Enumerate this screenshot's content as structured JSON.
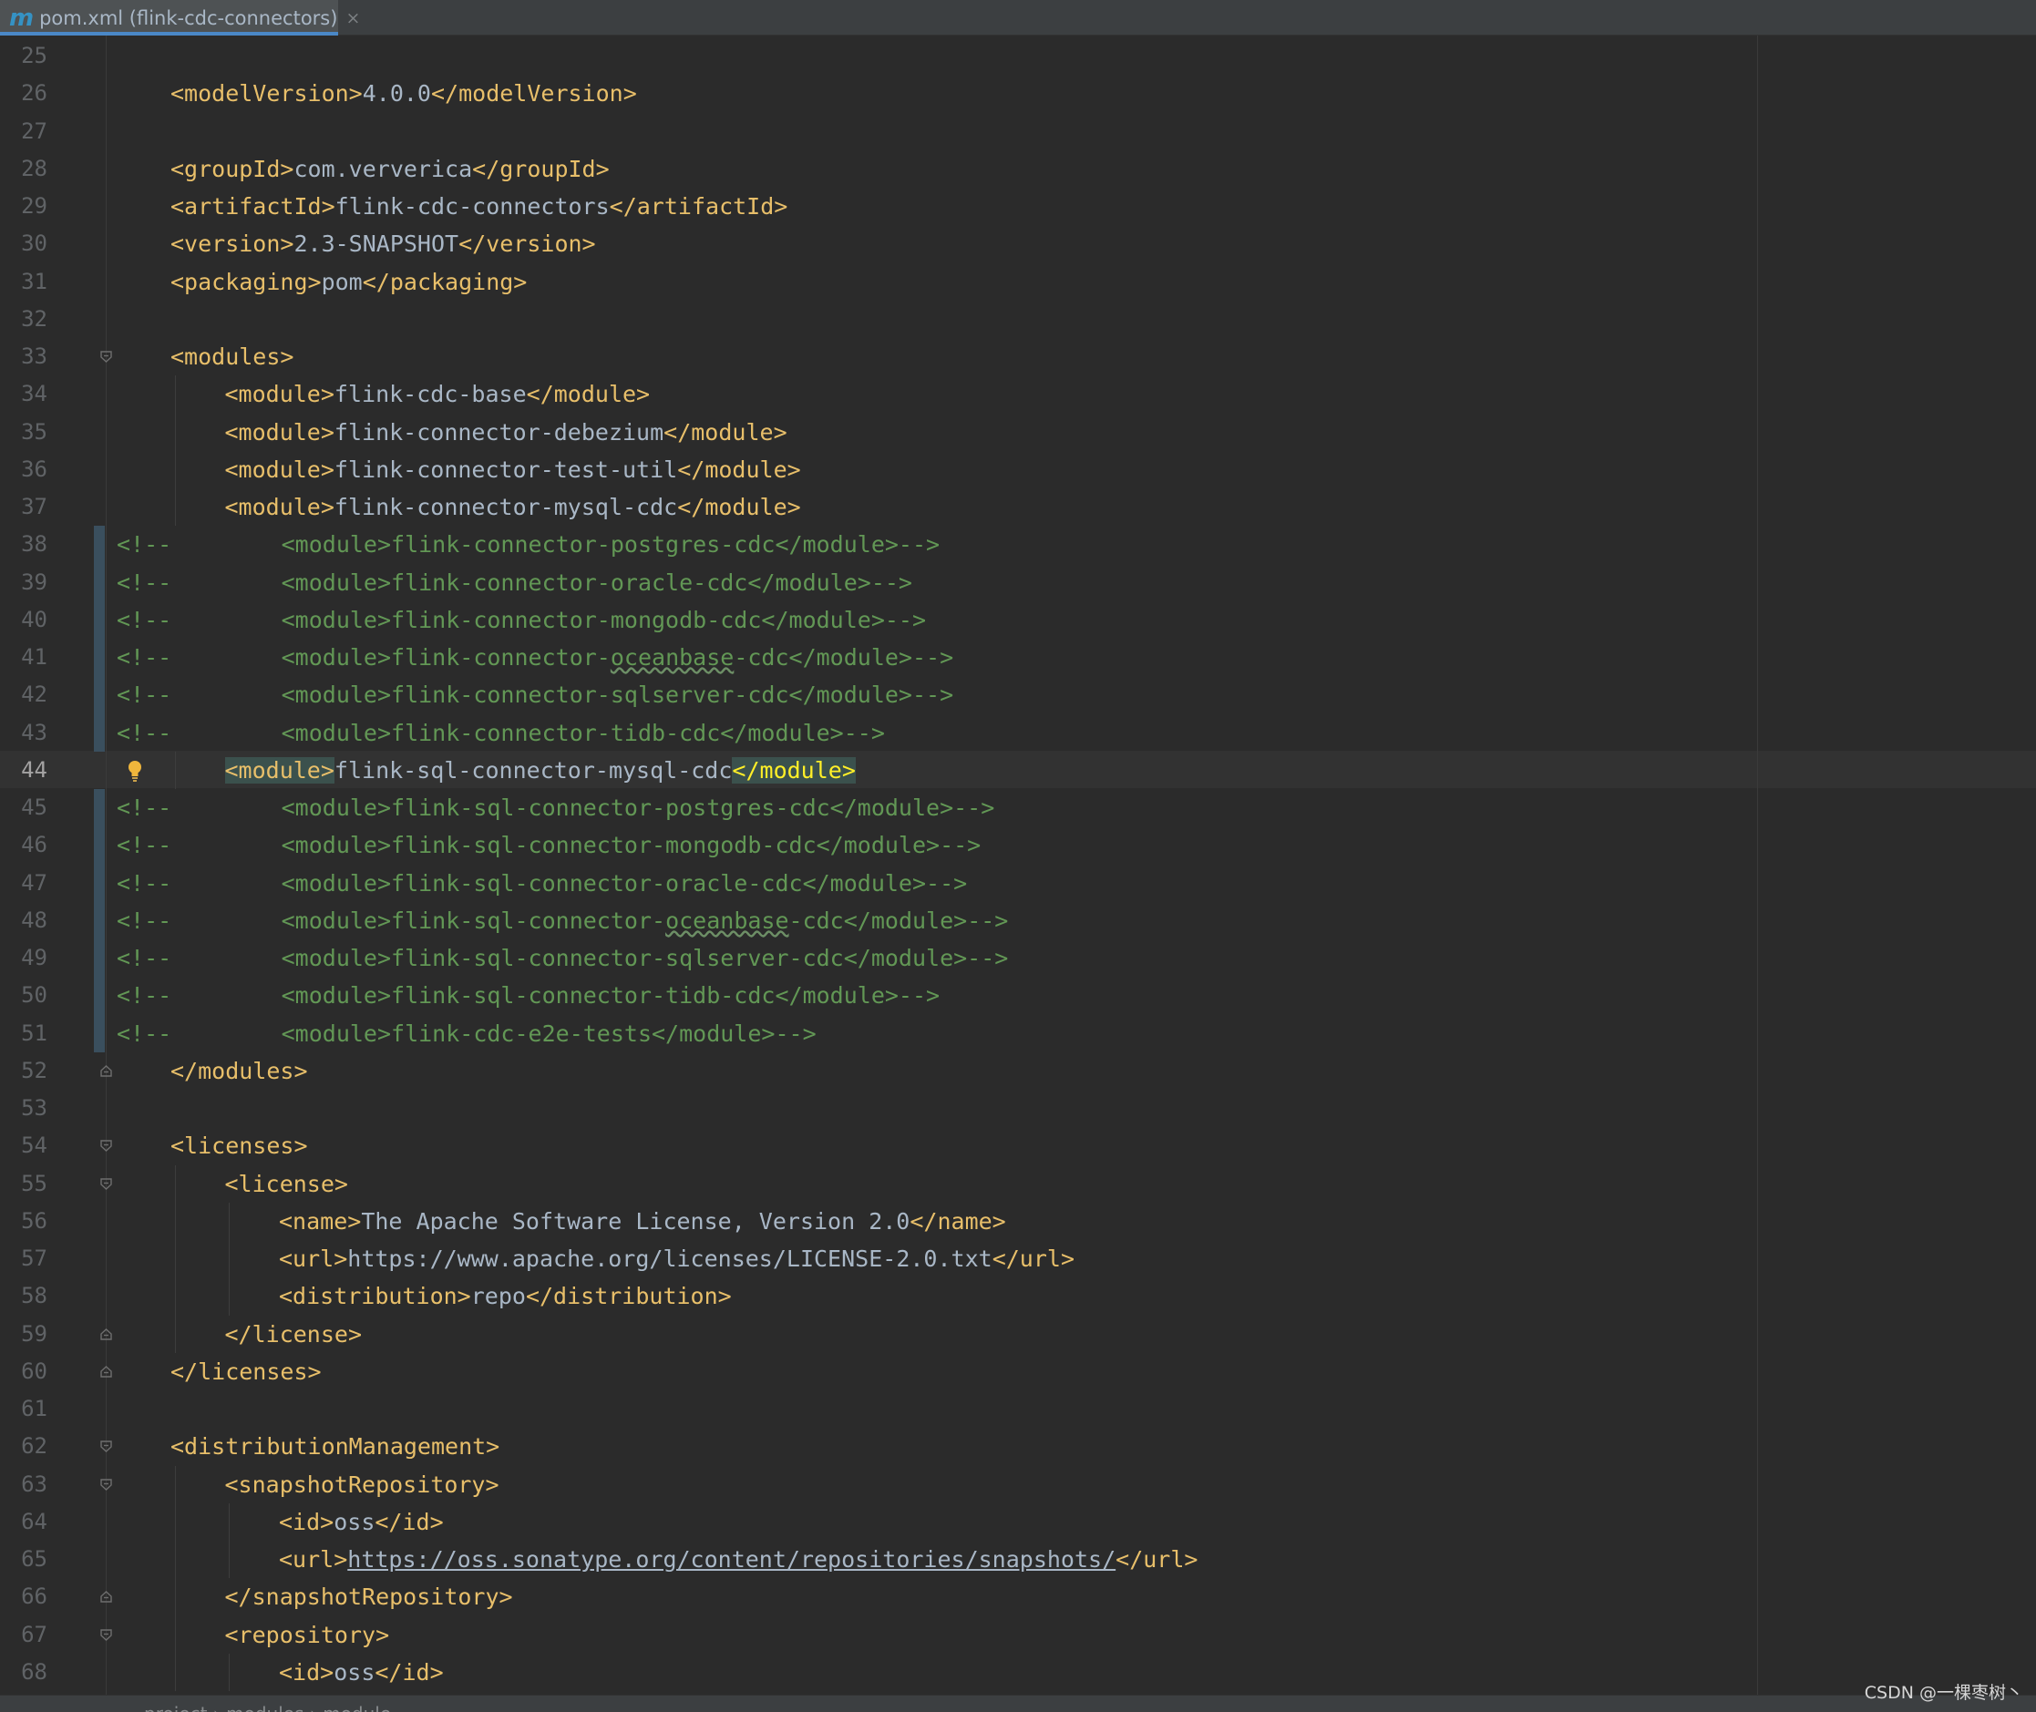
{
  "tab": {
    "icon": "m",
    "icon_name": "maven-icon",
    "title": "pom.xml (flink-cdc-connectors)",
    "close": "×"
  },
  "editor": {
    "current_line": 44,
    "lines": [
      {
        "n": "25",
        "parts": []
      },
      {
        "n": "26",
        "indent": 1,
        "parts": [
          [
            "tag",
            "<modelVersion>"
          ],
          [
            "txt",
            "4.0.0"
          ],
          [
            "tag",
            "</modelVersion>"
          ]
        ]
      },
      {
        "n": "27",
        "parts": []
      },
      {
        "n": "28",
        "indent": 1,
        "parts": [
          [
            "tag",
            "<groupId>"
          ],
          [
            "txt",
            "com.ververica"
          ],
          [
            "tag",
            "</groupId>"
          ]
        ]
      },
      {
        "n": "29",
        "indent": 1,
        "parts": [
          [
            "tag",
            "<artifactId>"
          ],
          [
            "txt",
            "flink-cdc-connectors"
          ],
          [
            "tag",
            "</artifactId>"
          ]
        ]
      },
      {
        "n": "30",
        "indent": 1,
        "parts": [
          [
            "tag",
            "<version>"
          ],
          [
            "txt",
            "2.3-SNAPSHOT"
          ],
          [
            "tag",
            "</version>"
          ]
        ]
      },
      {
        "n": "31",
        "indent": 1,
        "parts": [
          [
            "tag",
            "<packaging>"
          ],
          [
            "txt",
            "pom"
          ],
          [
            "tag",
            "</packaging>"
          ]
        ]
      },
      {
        "n": "32",
        "parts": []
      },
      {
        "n": "33",
        "indent": 1,
        "fold": "open",
        "parts": [
          [
            "tag",
            "<modules>"
          ]
        ]
      },
      {
        "n": "34",
        "indent": 2,
        "parts": [
          [
            "tag",
            "<module>"
          ],
          [
            "txt",
            "flink-cdc-base"
          ],
          [
            "tag",
            "</module>"
          ]
        ]
      },
      {
        "n": "35",
        "indent": 2,
        "parts": [
          [
            "tag",
            "<module>"
          ],
          [
            "txt",
            "flink-connector-debezium"
          ],
          [
            "tag",
            "</module>"
          ]
        ]
      },
      {
        "n": "36",
        "indent": 2,
        "parts": [
          [
            "tag",
            "<module>"
          ],
          [
            "txt",
            "flink-connector-test-util"
          ],
          [
            "tag",
            "</module>"
          ]
        ]
      },
      {
        "n": "37",
        "indent": 2,
        "parts": [
          [
            "tag",
            "<module>"
          ],
          [
            "txt",
            "flink-connector-mysql-cdc"
          ],
          [
            "tag",
            "</module>"
          ]
        ]
      },
      {
        "n": "38",
        "changed": true,
        "parts": [
          [
            "cmt",
            "<!--        <module>flink-connector-postgres-cdc</module>-->"
          ]
        ]
      },
      {
        "n": "39",
        "changed": true,
        "parts": [
          [
            "cmt",
            "<!--        <module>flink-connector-oracle-cdc</module>-->"
          ]
        ]
      },
      {
        "n": "40",
        "changed": true,
        "parts": [
          [
            "cmt",
            "<!--        <module>flink-connector-mongodb-cdc</module>-->"
          ]
        ]
      },
      {
        "n": "41",
        "changed": true,
        "parts": [
          [
            "cmt",
            "<!--        <module>flink-connector-"
          ],
          [
            "cmtw",
            "oceanbase"
          ],
          [
            "cmt",
            "-cdc</module>-->"
          ]
        ]
      },
      {
        "n": "42",
        "changed": true,
        "parts": [
          [
            "cmt",
            "<!--        <module>flink-connector-sqlserver-cdc</module>-->"
          ]
        ]
      },
      {
        "n": "43",
        "changed": true,
        "parts": [
          [
            "cmt",
            "<!--        <module>flink-connector-tidb-cdc</module>-->"
          ]
        ]
      },
      {
        "n": "44",
        "indent": 2,
        "bulb": true,
        "parts": [
          [
            "taghl",
            "<module>"
          ],
          [
            "txt",
            "flink-sql-connector-mysql-cdc"
          ],
          [
            "taghly",
            "</module>"
          ]
        ]
      },
      {
        "n": "45",
        "changed": true,
        "parts": [
          [
            "cmt",
            "<!--        <module>flink-sql-connector-postgres-cdc</module>-->"
          ]
        ]
      },
      {
        "n": "46",
        "changed": true,
        "parts": [
          [
            "cmt",
            "<!--        <module>flink-sql-connector-mongodb-cdc</module>-->"
          ]
        ]
      },
      {
        "n": "47",
        "changed": true,
        "parts": [
          [
            "cmt",
            "<!--        <module>flink-sql-connector-oracle-cdc</module>-->"
          ]
        ]
      },
      {
        "n": "48",
        "changed": true,
        "parts": [
          [
            "cmt",
            "<!--        <module>flink-sql-connector-"
          ],
          [
            "cmtw",
            "oceanbase"
          ],
          [
            "cmt",
            "-cdc</module>-->"
          ]
        ]
      },
      {
        "n": "49",
        "changed": true,
        "parts": [
          [
            "cmt",
            "<!--        <module>flink-sql-connector-sqlserver-cdc</module>-->"
          ]
        ]
      },
      {
        "n": "50",
        "changed": true,
        "parts": [
          [
            "cmt",
            "<!--        <module>flink-sql-connector-tidb-cdc</module>-->"
          ]
        ]
      },
      {
        "n": "51",
        "changed": true,
        "parts": [
          [
            "cmt",
            "<!--        <module>flink-cdc-e2e-tests</module>-->"
          ]
        ]
      },
      {
        "n": "52",
        "indent": 1,
        "fold": "close",
        "parts": [
          [
            "tag",
            "</modules>"
          ]
        ]
      },
      {
        "n": "53",
        "parts": []
      },
      {
        "n": "54",
        "indent": 1,
        "fold": "open",
        "parts": [
          [
            "tag",
            "<licenses>"
          ]
        ]
      },
      {
        "n": "55",
        "indent": 2,
        "fold": "open",
        "parts": [
          [
            "tag",
            "<license>"
          ]
        ]
      },
      {
        "n": "56",
        "indent": 3,
        "parts": [
          [
            "tag",
            "<name>"
          ],
          [
            "txt",
            "The Apache Software License, Version 2.0"
          ],
          [
            "tag",
            "</name>"
          ]
        ]
      },
      {
        "n": "57",
        "indent": 3,
        "parts": [
          [
            "tag",
            "<url>"
          ],
          [
            "txt",
            "https://www.apache.org/licenses/LICENSE-2.0.txt"
          ],
          [
            "tag",
            "</url>"
          ]
        ]
      },
      {
        "n": "58",
        "indent": 3,
        "parts": [
          [
            "tag",
            "<distribution>"
          ],
          [
            "txt",
            "repo"
          ],
          [
            "tag",
            "</distribution>"
          ]
        ]
      },
      {
        "n": "59",
        "indent": 2,
        "fold": "close",
        "parts": [
          [
            "tag",
            "</license>"
          ]
        ]
      },
      {
        "n": "60",
        "indent": 1,
        "fold": "close",
        "parts": [
          [
            "tag",
            "</licenses>"
          ]
        ]
      },
      {
        "n": "61",
        "parts": []
      },
      {
        "n": "62",
        "indent": 1,
        "fold": "open",
        "parts": [
          [
            "tag",
            "<distributionManagement>"
          ]
        ]
      },
      {
        "n": "63",
        "indent": 2,
        "fold": "open",
        "parts": [
          [
            "tag",
            "<snapshotRepository>"
          ]
        ]
      },
      {
        "n": "64",
        "indent": 3,
        "parts": [
          [
            "tag",
            "<id>"
          ],
          [
            "txt",
            "oss"
          ],
          [
            "tag",
            "</id>"
          ]
        ]
      },
      {
        "n": "65",
        "indent": 3,
        "parts": [
          [
            "tag",
            "<url>"
          ],
          [
            "url",
            "https://oss.sonatype.org/content/repositories/snapshots/"
          ],
          [
            "tag",
            "</url>"
          ]
        ]
      },
      {
        "n": "66",
        "indent": 2,
        "fold": "close",
        "parts": [
          [
            "tag",
            "</snapshotRepository>"
          ]
        ]
      },
      {
        "n": "67",
        "indent": 2,
        "fold": "open",
        "parts": [
          [
            "tag",
            "<repository>"
          ]
        ]
      },
      {
        "n": "68",
        "indent": 3,
        "parts": [
          [
            "tag",
            "<id>"
          ],
          [
            "txt",
            "oss"
          ],
          [
            "tag",
            "</id>"
          ]
        ]
      }
    ]
  },
  "breadcrumbs": {
    "text": "project  ›  modules  ›  module"
  },
  "watermark": "CSDN @一棵枣树丶",
  "colors": {
    "background": "#2b2b2b",
    "tag": "#e8bf6a",
    "text": "#a9b7c6",
    "comment": "#629755",
    "line_number": "#606366",
    "accent": "#4a88c7"
  }
}
